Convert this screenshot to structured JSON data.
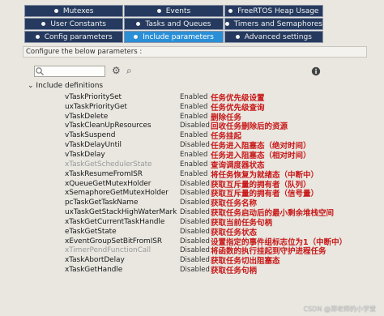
{
  "tabs": {
    "row1": [
      {
        "label": "Mutexes",
        "dot": true
      },
      {
        "label": "Events",
        "dot": true
      },
      {
        "label": "FreeRTOS Heap Usage",
        "dot": true
      }
    ],
    "row2": [
      {
        "label": "User Constants",
        "dot": true
      },
      {
        "label": "Tasks and Queues",
        "dot": true
      },
      {
        "label": "Timers and Semaphores",
        "dot": true
      }
    ],
    "row3": [
      {
        "label": "Config parameters",
        "dot": true,
        "active": false
      },
      {
        "label": "Include parameters",
        "dot": true,
        "active": true
      },
      {
        "label": "Advanced settings",
        "dot": true,
        "active": false
      }
    ]
  },
  "hint": "Configure the below parameters :",
  "tree": {
    "group_label": "Include definitions",
    "rows": [
      {
        "name": "vTaskPrioritySet",
        "value": "Enabled",
        "desc": "任务优先级设置",
        "disabled": false
      },
      {
        "name": "uxTaskPriorityGet",
        "value": "Enabled",
        "desc": "任务优先级查询",
        "disabled": false
      },
      {
        "name": "vTaskDelete",
        "value": "Enabled",
        "desc": "删除任务",
        "disabled": false
      },
      {
        "name": "vTaskCleanUpResources",
        "value": "Disabled",
        "desc": "回收任务删除后的资源",
        "disabled": false
      },
      {
        "name": "vTaskSuspend",
        "value": "Enabled",
        "desc": "任务挂起",
        "disabled": false
      },
      {
        "name": "vTaskDelayUntil",
        "value": "Disabled",
        "desc": "任务进入阻塞态（绝对时间）",
        "disabled": false
      },
      {
        "name": "vTaskDelay",
        "value": "Enabled",
        "desc": "任务进入阻塞态（相对时间）",
        "disabled": false
      },
      {
        "name": "xTaskGetSchedulerState",
        "value": "Enabled",
        "desc": "查询调度器状态",
        "disabled": true
      },
      {
        "name": "xTaskResumeFromISR",
        "value": "Enabled",
        "desc": "将任务恢复为就绪态（中断中）",
        "disabled": false
      },
      {
        "name": "xQueueGetMutexHolder",
        "value": "Disabled",
        "desc": "获取互斥量的拥有者（队列）",
        "disabled": false
      },
      {
        "name": "xSemaphoreGetMutexHolder",
        "value": "Disabled",
        "desc": "获取互斥量的拥有者（信号量）",
        "disabled": false
      },
      {
        "name": "pcTaskGetTaskName",
        "value": "Disabled",
        "desc": "获取任务名称",
        "disabled": false
      },
      {
        "name": "uxTaskGetStackHighWaterMark",
        "value": "Disabled",
        "desc": "获取任务启动后的最小剩余堆栈空间",
        "disabled": false
      },
      {
        "name": "xTaskGetCurrentTaskHandle",
        "value": "Disabled",
        "desc": "获取当前任务句柄",
        "disabled": false
      },
      {
        "name": "eTaskGetState",
        "value": "Disabled",
        "desc": "获取任务状态",
        "disabled": false
      },
      {
        "name": "xEventGroupSetBitFromISR",
        "value": "Disabled",
        "desc": "设置指定的事件组标志位为1（中断中）",
        "disabled": false
      },
      {
        "name": "xTimerPendFunctionCall",
        "value": "Disabled",
        "desc": "将函数的执行挂起到守护进程任务",
        "disabled": true
      },
      {
        "name": "xTaskAbortDelay",
        "value": "Disabled",
        "desc": "获取任务切出阻塞态",
        "disabled": false
      },
      {
        "name": "xTaskGetHandle",
        "value": "Disabled",
        "desc": "获取任务句柄",
        "disabled": false
      }
    ]
  },
  "icons": {
    "search": "search-icon",
    "settings": "settings-icon",
    "info": "info-icon",
    "expand": "chevron-down-icon"
  },
  "watermark": "CSDN @郑老师的小学堂"
}
